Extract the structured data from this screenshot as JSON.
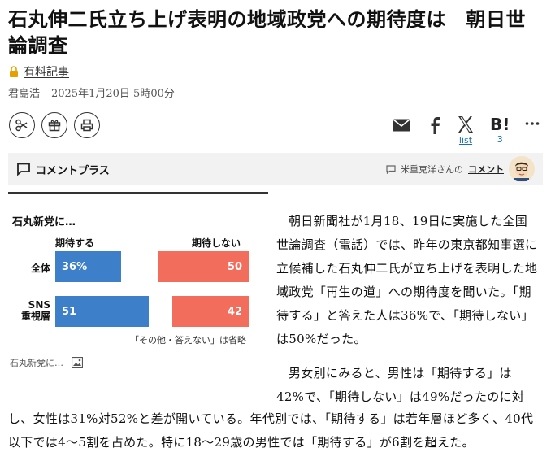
{
  "headline": "石丸伸二氏立ち上げ表明の地域政党への期待度は　朝日世論調査",
  "paid_label": "有料記事",
  "byline": {
    "author": "君島浩",
    "date": "2025年1月20日 5時00分"
  },
  "share": {
    "x_label": "list",
    "hatena_count": "3"
  },
  "icons": [
    "scissors-icon",
    "gift-icon",
    "print-icon",
    "mail-icon",
    "facebook-icon",
    "x-icon",
    "hatena-bookmark-icon",
    "more-icon"
  ],
  "comment_plus": {
    "title": "コメントプラス",
    "commenter_text": "米重克洋さんの",
    "link_text": "コメント"
  },
  "chart": {
    "title": "石丸新党に…",
    "col_expect": "期待する",
    "col_not_expect": "期待しない",
    "rows": [
      {
        "label": "全体",
        "expect": "36%",
        "not_expect": "50"
      },
      {
        "label_line1": "SNS",
        "label_line2": "重視層",
        "expect": "51",
        "not_expect": "42"
      }
    ],
    "note": "「その他・答えない」は省略",
    "caption": "石丸新党に…"
  },
  "chart_data": {
    "type": "bar",
    "title": "石丸新党に…",
    "categories": [
      "全体",
      "SNS重視層"
    ],
    "series": [
      {
        "name": "期待する",
        "values": [
          36,
          51
        ],
        "color": "#3d7fc9"
      },
      {
        "name": "期待しない",
        "values": [
          50,
          42
        ],
        "color": "#f26d5b"
      }
    ],
    "xlabel": "",
    "ylabel": ""
  },
  "article": {
    "para1": "朝日新聞社が1月18、19日に実施した全国世論調査（電話）では、昨年の東京都知事選に立候補した石丸伸二氏が立ち上げを表明した地域政党「再生の道」への期待度を聞いた。「期待する」と答えた人は36%で、「期待しない」は50%だった。",
    "para2_top": "男女別にみると、男性は「期待する」は42%で、「期待しない」は49%だったのに対",
    "para2_rest": "し、女性は31%対52%と差が開いている。年代別では、「期待する」は若年層ほど多く、40代以下では4～5割を占めた。特に18～29歳の男性では「期待する」が6割を超えた。"
  }
}
